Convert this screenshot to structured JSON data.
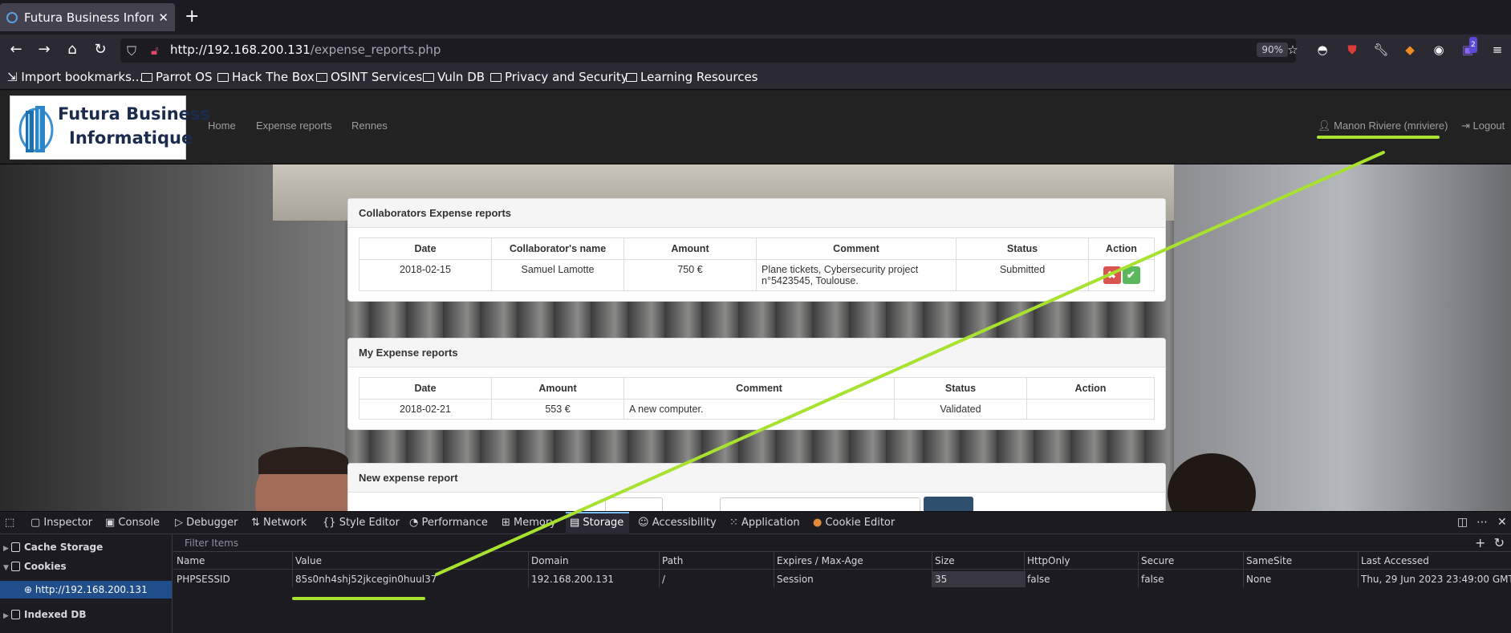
{
  "browser": {
    "tab_title": "Futura Business Informat",
    "tab_close": "✕",
    "new_tab": "+",
    "url_host": "http://192.168.200.131",
    "url_path": "/expense_reports.php",
    "zoom": "90%",
    "extension_badge": "2"
  },
  "bookmarks": [
    "Import bookmarks...",
    "Parrot OS",
    "Hack The Box",
    "OSINT Services",
    "Vuln DB",
    "Privacy and Security",
    "Learning Resources"
  ],
  "site": {
    "logo_line1": "Futura Business",
    "logo_line2": "Informatique",
    "nav": [
      "Home",
      "Expense reports",
      "Rennes"
    ],
    "user": "Manon Riviere (mriviere)",
    "logout": "Logout"
  },
  "collab_panel": {
    "title": "Collaborators Expense reports",
    "headers": [
      "Date",
      "Collaborator's name",
      "Amount",
      "Comment",
      "Status",
      "Action"
    ],
    "rows": [
      {
        "date": "2018-02-15",
        "name": "Samuel Lamotte",
        "amount": "750 €",
        "comment_line1": "Plane tickets, Cybersecurity project",
        "comment_line2": "n°5423545, Toulouse.",
        "status": "Submitted",
        "reject_icon": "✖",
        "accept_icon": "✔"
      }
    ]
  },
  "my_panel": {
    "title": "My Expense reports",
    "headers": [
      "Date",
      "Amount",
      "Comment",
      "Status",
      "Action"
    ],
    "rows": [
      {
        "date": "2018-02-21",
        "amount": "553 €",
        "comment": "A new computer.",
        "status": "Validated",
        "action": ""
      }
    ]
  },
  "new_panel": {
    "title": "New expense report"
  },
  "devtools": {
    "tabs": [
      "Inspector",
      "Console",
      "Debugger",
      "Network",
      "Style Editor",
      "Performance",
      "Memory",
      "Storage",
      "Accessibility",
      "Application",
      "Cookie Editor"
    ],
    "selected_tab": "Storage",
    "sidebar": {
      "cache_storage": "Cache Storage",
      "cookies": "Cookies",
      "cookie_host": "http://192.168.200.131",
      "indexed_db": "Indexed DB"
    },
    "filter_placeholder": "Filter Items",
    "columns": [
      "Name",
      "Value",
      "Domain",
      "Path",
      "Expires / Max-Age",
      "Size",
      "HttpOnly",
      "Secure",
      "SameSite",
      "Last Accessed"
    ],
    "cookie": {
      "name": "PHPSESSID",
      "value": "85s0nh4shj52jkcegin0huul37",
      "domain": "192.168.200.131",
      "path": "/",
      "expires": "Session",
      "size": "35",
      "httponly": "false",
      "secure": "false",
      "samesite": "None",
      "last_accessed": "Thu, 29 Jun 2023 23:49:00 GMT"
    }
  },
  "colors": {
    "annotation": "#a6e22e",
    "navbar_dark": "#222222",
    "devtools_selection": "#204e8a"
  }
}
